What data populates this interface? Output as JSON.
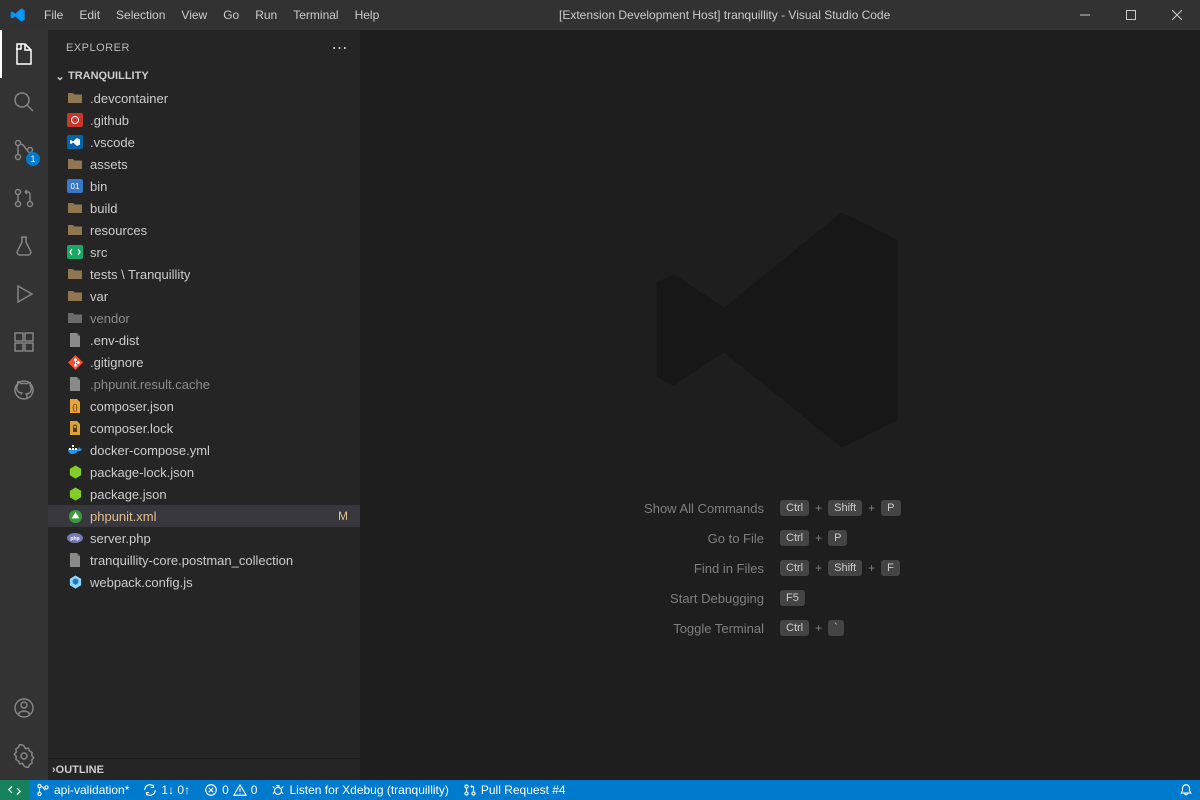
{
  "title": "[Extension Development Host] tranquillity - Visual Studio Code",
  "menu": [
    "File",
    "Edit",
    "Selection",
    "View",
    "Go",
    "Run",
    "Terminal",
    "Help"
  ],
  "explorer": {
    "title": "EXPLORER",
    "project": "TRANQUILLITY",
    "outline": "OUTLINE",
    "items": [
      {
        "kind": "folder",
        "label": ".devcontainer",
        "dim": false,
        "icon": "folder-brown"
      },
      {
        "kind": "folder",
        "label": ".github",
        "dim": false,
        "icon": "github-folder"
      },
      {
        "kind": "folder",
        "label": ".vscode",
        "dim": false,
        "icon": "vscode-folder"
      },
      {
        "kind": "folder",
        "label": "assets",
        "dim": false,
        "icon": "folder-brown"
      },
      {
        "kind": "folder",
        "label": "bin",
        "dim": false,
        "icon": "bin-folder"
      },
      {
        "kind": "folder",
        "label": "build",
        "dim": false,
        "icon": "folder-brown"
      },
      {
        "kind": "folder",
        "label": "resources",
        "dim": false,
        "icon": "folder-brown"
      },
      {
        "kind": "folder",
        "label": "src",
        "dim": false,
        "icon": "src-folder"
      },
      {
        "kind": "folder",
        "label": "tests \\ Tranquillity",
        "dim": false,
        "icon": "folder-brown"
      },
      {
        "kind": "folder",
        "label": "var",
        "dim": false,
        "icon": "folder-brown"
      },
      {
        "kind": "folder",
        "label": "vendor",
        "dim": true,
        "icon": "folder-gray"
      },
      {
        "kind": "file",
        "label": ".env-dist",
        "dim": false,
        "icon": "file-gray"
      },
      {
        "kind": "file",
        "label": ".gitignore",
        "dim": false,
        "icon": "git-icon"
      },
      {
        "kind": "file",
        "label": ".phpunit.result.cache",
        "dim": true,
        "icon": "file-gray"
      },
      {
        "kind": "file",
        "label": "composer.json",
        "dim": false,
        "icon": "composer-json"
      },
      {
        "kind": "file",
        "label": "composer.lock",
        "dim": false,
        "icon": "composer-lock"
      },
      {
        "kind": "file",
        "label": "docker-compose.yml",
        "dim": false,
        "icon": "docker-icon"
      },
      {
        "kind": "file",
        "label": "package-lock.json",
        "dim": false,
        "icon": "node-icon"
      },
      {
        "kind": "file",
        "label": "package.json",
        "dim": false,
        "icon": "node-icon"
      },
      {
        "kind": "file",
        "label": "phpunit.xml",
        "dim": false,
        "icon": "phpunit-icon",
        "modified": true,
        "selected": true,
        "decor": "M"
      },
      {
        "kind": "file",
        "label": "server.php",
        "dim": false,
        "icon": "php-icon"
      },
      {
        "kind": "file",
        "label": "tranquillity-core.postman_collection",
        "dim": false,
        "icon": "file-gray"
      },
      {
        "kind": "file",
        "label": "webpack.config.js",
        "dim": false,
        "icon": "webpack-icon"
      }
    ]
  },
  "scm_badge": "1",
  "shortcuts": [
    {
      "label": "Show All Commands",
      "keys": [
        "Ctrl",
        "Shift",
        "P"
      ]
    },
    {
      "label": "Go to File",
      "keys": [
        "Ctrl",
        "P"
      ]
    },
    {
      "label": "Find in Files",
      "keys": [
        "Ctrl",
        "Shift",
        "F"
      ]
    },
    {
      "label": "Start Debugging",
      "keys": [
        "F5"
      ]
    },
    {
      "label": "Toggle Terminal",
      "keys": [
        "Ctrl",
        "`"
      ]
    }
  ],
  "status": {
    "branch": "api-validation*",
    "sync": "1↓ 0↑",
    "errors": "0",
    "warnings": "0",
    "debug": "Listen for Xdebug (tranquillity)",
    "pr": "Pull Request #4"
  }
}
